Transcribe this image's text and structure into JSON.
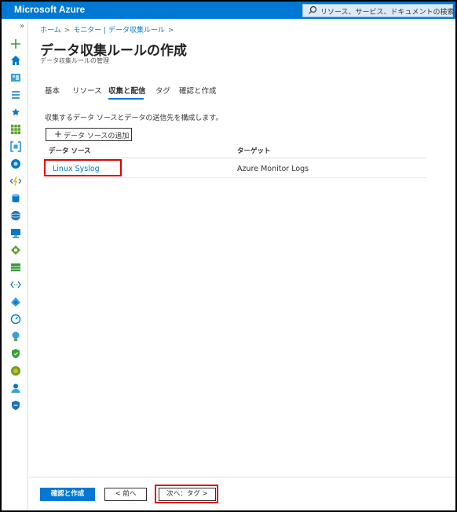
{
  "app": {
    "brand": "Microsoft Azure"
  },
  "search": {
    "placeholder": "リソース、サービス、ドキュメントの検索 (G+/)"
  },
  "sidebar": {
    "collapse_glyph": "»"
  },
  "breadcrumb": {
    "items": [
      "ホーム",
      "モニター | データ収集ルール"
    ],
    "trailing": ">"
  },
  "page": {
    "title": "データ収集ルールの作成",
    "more": "···",
    "subtitle": "データ収集ルールの管理"
  },
  "tabs": [
    {
      "label": "基本",
      "active": false
    },
    {
      "label": "リソース",
      "active": false
    },
    {
      "label": "収集と配信",
      "active": true
    },
    {
      "label": "タグ",
      "active": false
    },
    {
      "label": "確認と作成",
      "active": false
    }
  ],
  "content": {
    "description": "収集するデータ ソースとデータの送信先を構成します。",
    "add_button": {
      "plus": "+",
      "label": "データ ソースの追加"
    },
    "table": {
      "headers": [
        "データ ソース",
        "ターゲット"
      ],
      "rows": [
        {
          "source": "Linux Syslog",
          "target": "Azure Monitor Logs"
        }
      ]
    }
  },
  "footer": {
    "review_create": "確認と作成",
    "prev": "< 前へ",
    "next": "次へ：タグ >"
  },
  "colors": {
    "accent": "#0078d4",
    "highlight": "#e00000"
  },
  "icons": [
    "plus-icon",
    "home-icon",
    "dashboard-icon",
    "all-services-icon",
    "favorites-star-icon",
    "all-resources-icon",
    "resource-groups-icon",
    "globe-icon",
    "functions-icon",
    "sql-icon",
    "cosmos-icon",
    "vm-icon",
    "load-balancer-icon",
    "storage-icon",
    "network-icon",
    "azure-ad-icon",
    "monitor-icon",
    "advisor-icon",
    "defender-icon",
    "cost-icon",
    "help-support-icon",
    "shield-icon"
  ]
}
